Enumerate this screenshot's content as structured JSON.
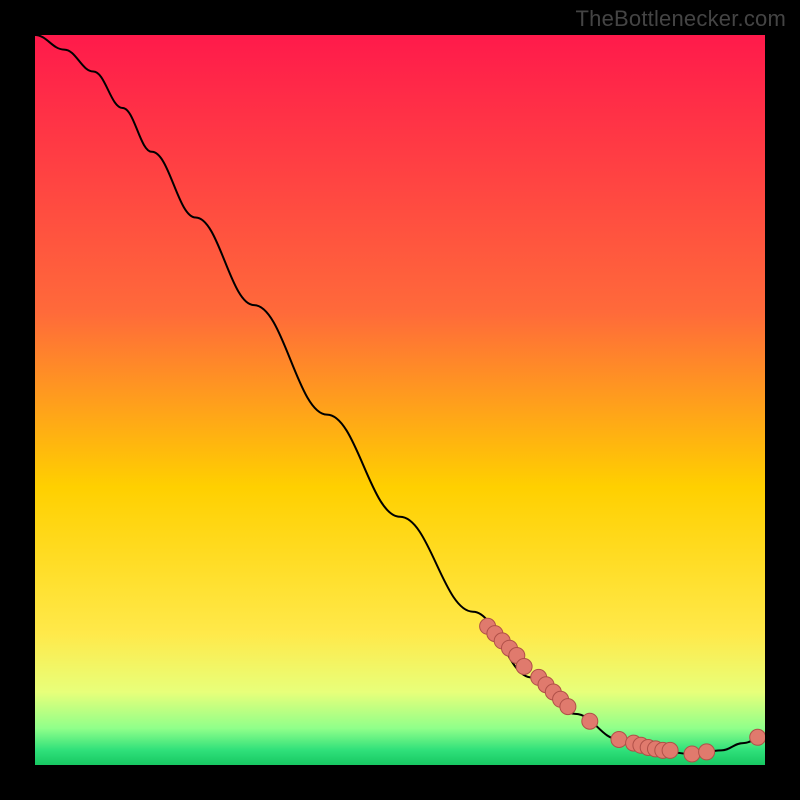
{
  "watermark": "TheBottlenecker.com",
  "colors": {
    "gradient_top": "#ff1a4b",
    "gradient_mid": "#ffd000",
    "gradient_band_light": "#e8ff7a",
    "gradient_band_green": "#2fe07a",
    "line": "#000000",
    "marker_fill": "#e07a6d",
    "marker_stroke": "#b05048",
    "marker_hover": "#5fe08a"
  },
  "chart_data": {
    "type": "line",
    "title": "",
    "xlabel": "",
    "ylabel": "",
    "xlim": [
      0,
      100
    ],
    "ylim": [
      0,
      100
    ],
    "curve": [
      {
        "x": 0,
        "y": 100
      },
      {
        "x": 4,
        "y": 98
      },
      {
        "x": 8,
        "y": 95
      },
      {
        "x": 12,
        "y": 90
      },
      {
        "x": 16,
        "y": 84
      },
      {
        "x": 22,
        "y": 75
      },
      {
        "x": 30,
        "y": 63
      },
      {
        "x": 40,
        "y": 48
      },
      {
        "x": 50,
        "y": 34
      },
      {
        "x": 60,
        "y": 21
      },
      {
        "x": 68,
        "y": 12
      },
      {
        "x": 74,
        "y": 7
      },
      {
        "x": 80,
        "y": 3.5
      },
      {
        "x": 85,
        "y": 2
      },
      {
        "x": 90,
        "y": 1.5
      },
      {
        "x": 94,
        "y": 2
      },
      {
        "x": 97,
        "y": 3
      },
      {
        "x": 100,
        "y": 4
      }
    ],
    "markers": [
      {
        "x": 62,
        "y": 19
      },
      {
        "x": 63,
        "y": 18
      },
      {
        "x": 64,
        "y": 17
      },
      {
        "x": 65,
        "y": 16
      },
      {
        "x": 66,
        "y": 15
      },
      {
        "x": 67,
        "y": 13.5
      },
      {
        "x": 69,
        "y": 12
      },
      {
        "x": 70,
        "y": 11
      },
      {
        "x": 71,
        "y": 10
      },
      {
        "x": 72,
        "y": 9
      },
      {
        "x": 73,
        "y": 8
      },
      {
        "x": 76,
        "y": 6
      },
      {
        "x": 80,
        "y": 3.5
      },
      {
        "x": 82,
        "y": 3
      },
      {
        "x": 83,
        "y": 2.7
      },
      {
        "x": 84,
        "y": 2.4
      },
      {
        "x": 85,
        "y": 2.2
      },
      {
        "x": 86,
        "y": 2
      },
      {
        "x": 87,
        "y": 2
      },
      {
        "x": 90,
        "y": 1.5
      },
      {
        "x": 92,
        "y": 1.8
      },
      {
        "x": 99,
        "y": 3.8
      }
    ]
  }
}
